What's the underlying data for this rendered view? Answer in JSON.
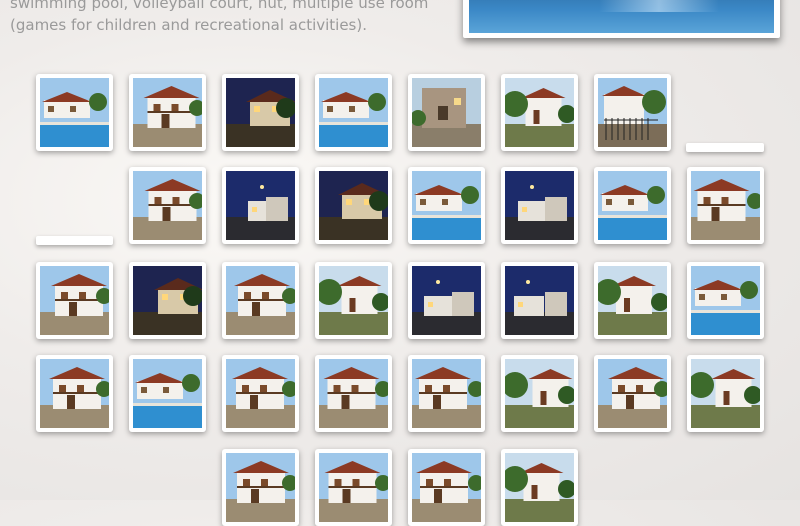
{
  "page": {
    "intro_text": "swimming pool, volleyball court, hut, multiple use room (games for children and recreational activities)."
  },
  "hero": {
    "name": "featured-pool-photo"
  },
  "gallery": {
    "thumbnails": [
      {
        "id": "pool-day-1",
        "scene": "pool"
      },
      {
        "id": "pool-dusk-1",
        "scene": "pool-dusk"
      },
      {
        "id": "facade-night-1",
        "scene": "night"
      },
      {
        "id": "pool-umbrella",
        "scene": "pool"
      },
      {
        "id": "stone-house",
        "scene": "stone"
      },
      {
        "id": "garden-path-1",
        "scene": "garden"
      },
      {
        "id": "gate-house",
        "scene": "gate"
      },
      {
        "id": "white-house-1",
        "scene": "house"
      },
      {
        "id": "street-night-1",
        "scene": "night-blue"
      },
      {
        "id": "garden-night",
        "scene": "night"
      },
      {
        "id": "pool-loungers",
        "scene": "pool"
      },
      {
        "id": "pool-night",
        "scene": "night-blue"
      },
      {
        "id": "pool-terrace",
        "scene": "pool"
      },
      {
        "id": "white-house-2",
        "scene": "house"
      },
      {
        "id": "house-dusk-1",
        "scene": "house"
      },
      {
        "id": "porch-night",
        "scene": "night"
      },
      {
        "id": "stairs-house",
        "scene": "house"
      },
      {
        "id": "balcony-house",
        "scene": "garden"
      },
      {
        "id": "street-night-2",
        "scene": "night-blue"
      },
      {
        "id": "street-night-3",
        "scene": "night-blue"
      },
      {
        "id": "patio-sign",
        "scene": "garden"
      },
      {
        "id": "pool-chairs",
        "scene": "pool"
      },
      {
        "id": "lawn-house",
        "scene": "house"
      },
      {
        "id": "pool-day-2",
        "scene": "pool"
      },
      {
        "id": "pool-balcony",
        "scene": "house"
      },
      {
        "id": "fence-house",
        "scene": "house"
      },
      {
        "id": "stairs-red",
        "scene": "house"
      },
      {
        "id": "house-trees",
        "scene": "garden"
      },
      {
        "id": "courtyard-1",
        "scene": "house"
      },
      {
        "id": "palm-road",
        "scene": "garden"
      },
      {
        "id": "house-row-1",
        "scene": "house"
      },
      {
        "id": "house-row-2",
        "scene": "house"
      },
      {
        "id": "house-row-3",
        "scene": "house"
      },
      {
        "id": "house-row-4",
        "scene": "garden"
      }
    ]
  },
  "colors": {
    "sky_day": "#9ec7ea",
    "sky_night": "#1c2b6b",
    "pool": "#2f8fd0",
    "wall_white": "#f4f1ec",
    "roof": "#8c3a24",
    "foliage": "#3d6b2c"
  }
}
